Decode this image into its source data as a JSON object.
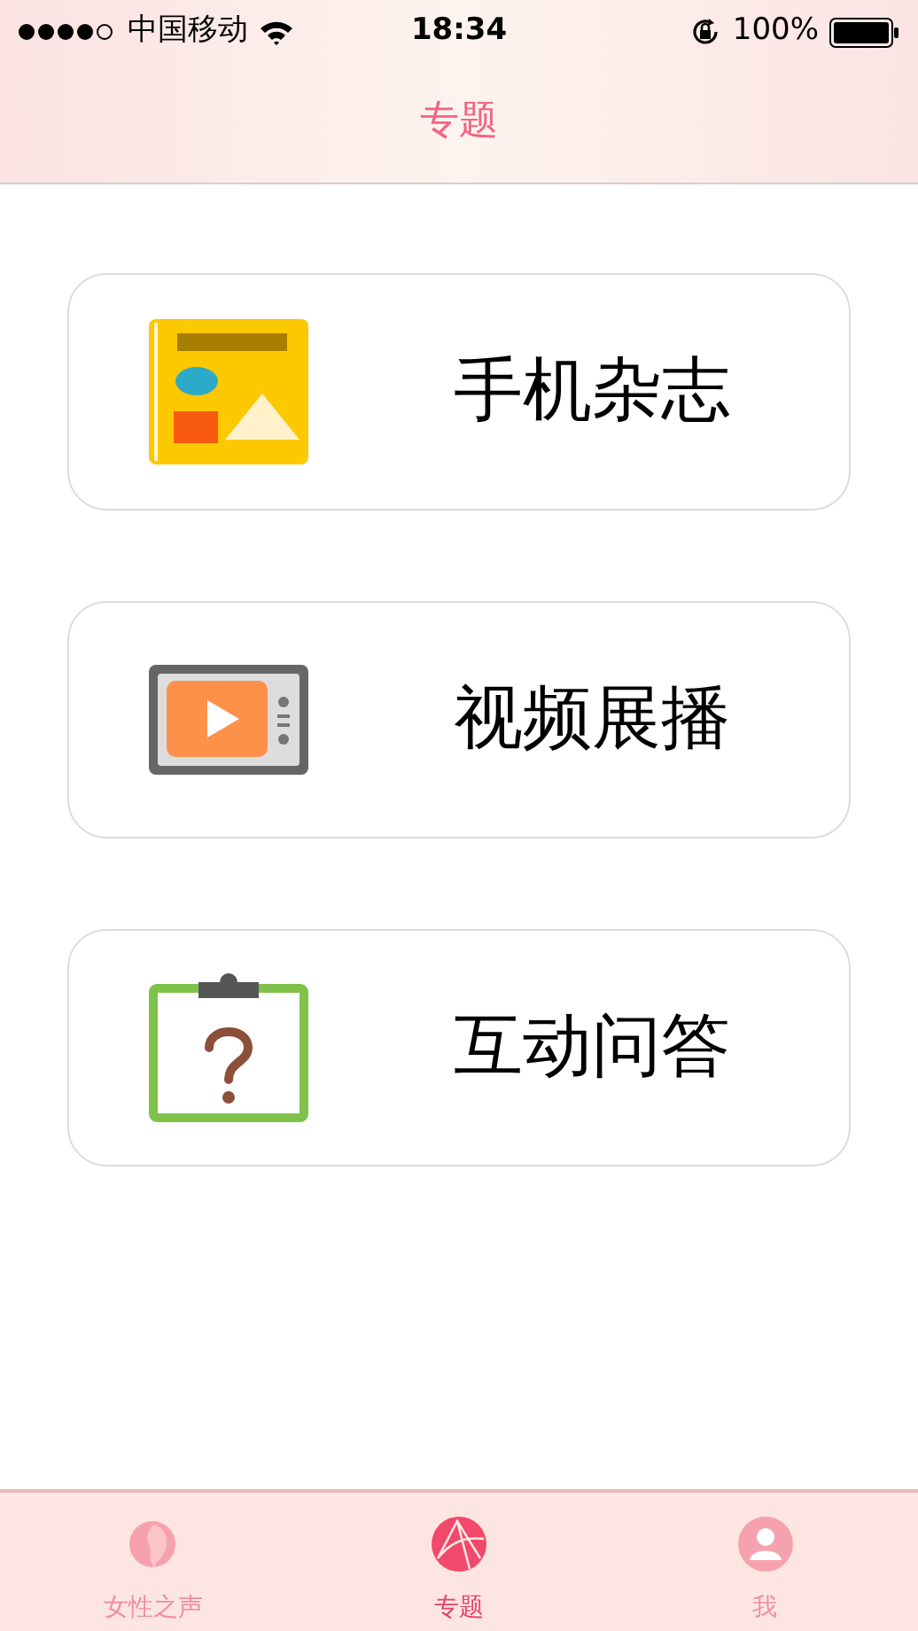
{
  "status_bar": {
    "carrier": "中国移动",
    "time": "18:34",
    "battery": "100%"
  },
  "nav": {
    "title": "专题"
  },
  "cards": [
    {
      "kind": "magazine",
      "label": "手机杂志"
    },
    {
      "kind": "video",
      "label": "视频展播"
    },
    {
      "kind": "quiz",
      "label": "互动问答"
    }
  ],
  "tabs": [
    {
      "kind": "voice",
      "label": "女性之声",
      "selected": false
    },
    {
      "kind": "topic",
      "label": "专题",
      "selected": true
    },
    {
      "kind": "me",
      "label": "我",
      "selected": false
    }
  ]
}
